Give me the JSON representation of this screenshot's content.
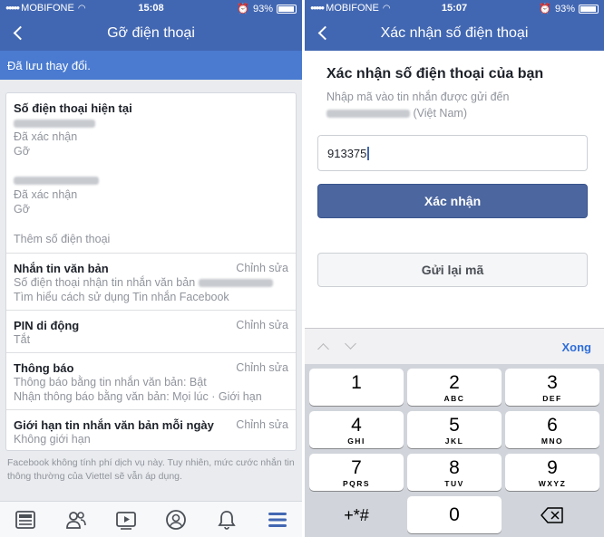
{
  "left": {
    "status": {
      "carrier": "MOBIFONE",
      "time": "15:08",
      "battery": "93%"
    },
    "title": "Gỡ điện thoại",
    "saved_banner": "Đã lưu thay đổi.",
    "phones": {
      "header": "Số điện thoại hiện tại",
      "items": [
        {
          "status": "Đã xác nhận",
          "remove": "Gỡ"
        },
        {
          "status": "Đã xác nhận",
          "remove": "Gỡ"
        }
      ],
      "add": "Thêm số điện thoại"
    },
    "sms": {
      "title": "Nhắn tin văn bản",
      "edit": "Chỉnh sửa",
      "line1": "Số điện thoại nhận tin nhắn văn bản",
      "line2": "Tìm hiểu cách sử dụng Tin nhắn Facebook"
    },
    "pin": {
      "title": "PIN di động",
      "edit": "Chỉnh sửa",
      "value": "Tắt"
    },
    "notify": {
      "title": "Thông báo",
      "edit": "Chỉnh sửa",
      "line1": "Thông báo bằng tin nhắn văn bản: Bật",
      "line2": "Nhận thông báo bằng văn bản: Mọi lúc · Giới hạn"
    },
    "limit": {
      "title": "Giới hạn tin nhắn văn bản mỗi ngày",
      "edit": "Chỉnh sửa",
      "value": "Không giới hạn"
    },
    "footnote": "Facebook không tính phí dịch vụ này. Tuy nhiên, mức cước nhắn tin thông thường của Viettel sẽ vẫn áp dụng.",
    "tabs": [
      "news-feed-icon",
      "friends-icon",
      "watch-icon",
      "profile-icon",
      "notifications-icon",
      "menu-icon"
    ]
  },
  "right": {
    "status": {
      "carrier": "MOBIFONE",
      "time": "15:07",
      "battery": "93%"
    },
    "title": "Xác nhận số điện thoại",
    "heading": "Xác nhận số điện thoại của bạn",
    "desc1": "Nhập mã vào tin nhắn được gửi đến",
    "desc2": "(Việt Nam)",
    "code_value": "913375",
    "confirm": "Xác nhận",
    "resend": "Gửi lại mã",
    "done": "Xong",
    "keys": [
      {
        "n": "1",
        "l": ""
      },
      {
        "n": "2",
        "l": "ABC"
      },
      {
        "n": "3",
        "l": "DEF"
      },
      {
        "n": "4",
        "l": "GHI"
      },
      {
        "n": "5",
        "l": "JKL"
      },
      {
        "n": "6",
        "l": "MNO"
      },
      {
        "n": "7",
        "l": "PQRS"
      },
      {
        "n": "8",
        "l": "TUV"
      },
      {
        "n": "9",
        "l": "WXYZ"
      },
      {
        "n": "+*#",
        "l": ""
      },
      {
        "n": "0",
        "l": ""
      },
      {
        "n": "",
        "l": ""
      }
    ]
  },
  "colors": {
    "brand": "#4267b2",
    "banner": "#4a7bd0",
    "active_tab": "#4267b2",
    "done": "#2f6ed9"
  }
}
